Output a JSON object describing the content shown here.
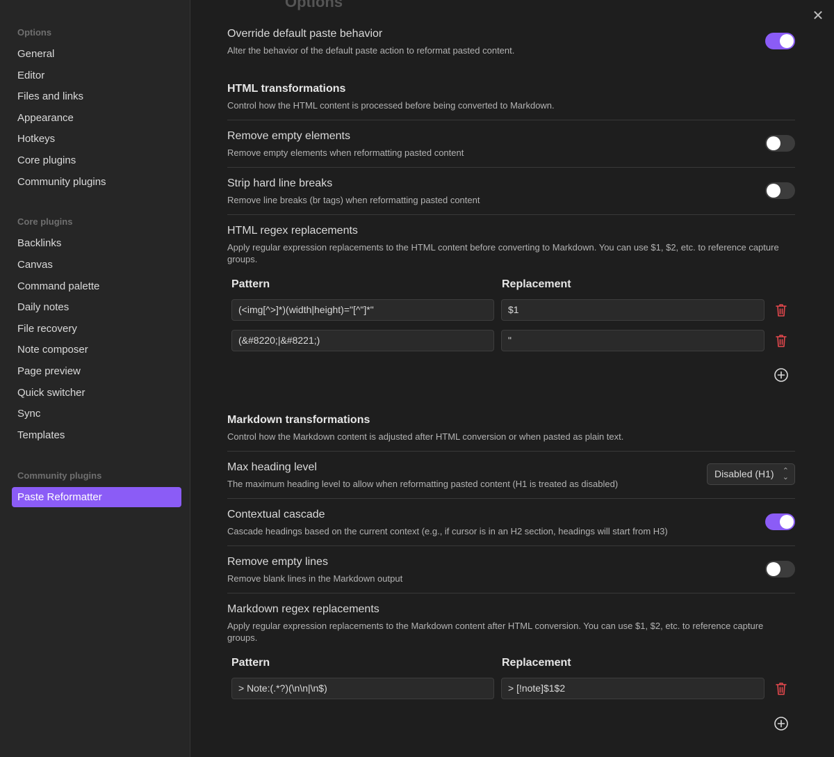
{
  "ghost_header": "Options",
  "close_glyph": "✕",
  "sidebar": {
    "options_title": "Options",
    "options_items": [
      "General",
      "Editor",
      "Files and links",
      "Appearance",
      "Hotkeys",
      "Core plugins",
      "Community plugins"
    ],
    "core_title": "Core plugins",
    "core_items": [
      "Backlinks",
      "Canvas",
      "Command palette",
      "Daily notes",
      "File recovery",
      "Note composer",
      "Page preview",
      "Quick switcher",
      "Sync",
      "Templates"
    ],
    "community_title": "Community plugins",
    "community_items": [
      "Paste Reformatter"
    ],
    "active_item": "Paste Reformatter"
  },
  "settings": {
    "override": {
      "name": "Override default paste behavior",
      "desc": "Alter the behavior of the default paste action to reformat pasted content.",
      "enabled": true
    },
    "html_heading": {
      "name": "HTML transformations",
      "desc": "Control how the HTML content is processed before being converted to Markdown."
    },
    "remove_empty_elements": {
      "name": "Remove empty elements",
      "desc": "Remove empty elements when reformatting pasted content",
      "enabled": false
    },
    "strip_line_breaks": {
      "name": "Strip hard line breaks",
      "desc": "Remove line breaks (br tags) when reformatting pasted content",
      "enabled": false
    },
    "html_regex": {
      "name": "HTML regex replacements",
      "desc": "Apply regular expression replacements to the HTML content before converting to Markdown. You can use $1, $2, etc. to reference capture groups.",
      "pattern_header": "Pattern",
      "replacement_header": "Replacement",
      "rows": [
        {
          "pattern": "(<img[^>]*)(width|height)=\"[^\"]*\"",
          "replacement": "$1"
        },
        {
          "pattern": "(&#8220;|&#8221;)",
          "replacement": "\""
        }
      ]
    },
    "md_heading": {
      "name": "Markdown transformations",
      "desc": "Control how the Markdown content is adjusted after HTML conversion or when pasted as plain text."
    },
    "max_heading": {
      "name": "Max heading level",
      "desc": "The maximum heading level to allow when reformatting pasted content (H1 is treated as disabled)",
      "value": "Disabled (H1)"
    },
    "contextual_cascade": {
      "name": "Contextual cascade",
      "desc": "Cascade headings based on the current context (e.g., if cursor is in an H2 section, headings will start from H3)",
      "enabled": true
    },
    "remove_empty_lines": {
      "name": "Remove empty lines",
      "desc": "Remove blank lines in the Markdown output",
      "enabled": false
    },
    "md_regex": {
      "name": "Markdown regex replacements",
      "desc": "Apply regular expression replacements to the Markdown content after HTML conversion. You can use $1, $2, etc. to reference capture groups.",
      "pattern_header": "Pattern",
      "replacement_header": "Replacement",
      "rows": [
        {
          "pattern": "> Note:(.*?)(\\n\\n|\\n$)",
          "replacement": "> [!note]$1$2"
        }
      ]
    }
  },
  "colors": {
    "accent": "#8b5cf6",
    "danger": "#e5484d",
    "toggle_off": "#3c3c3c"
  }
}
